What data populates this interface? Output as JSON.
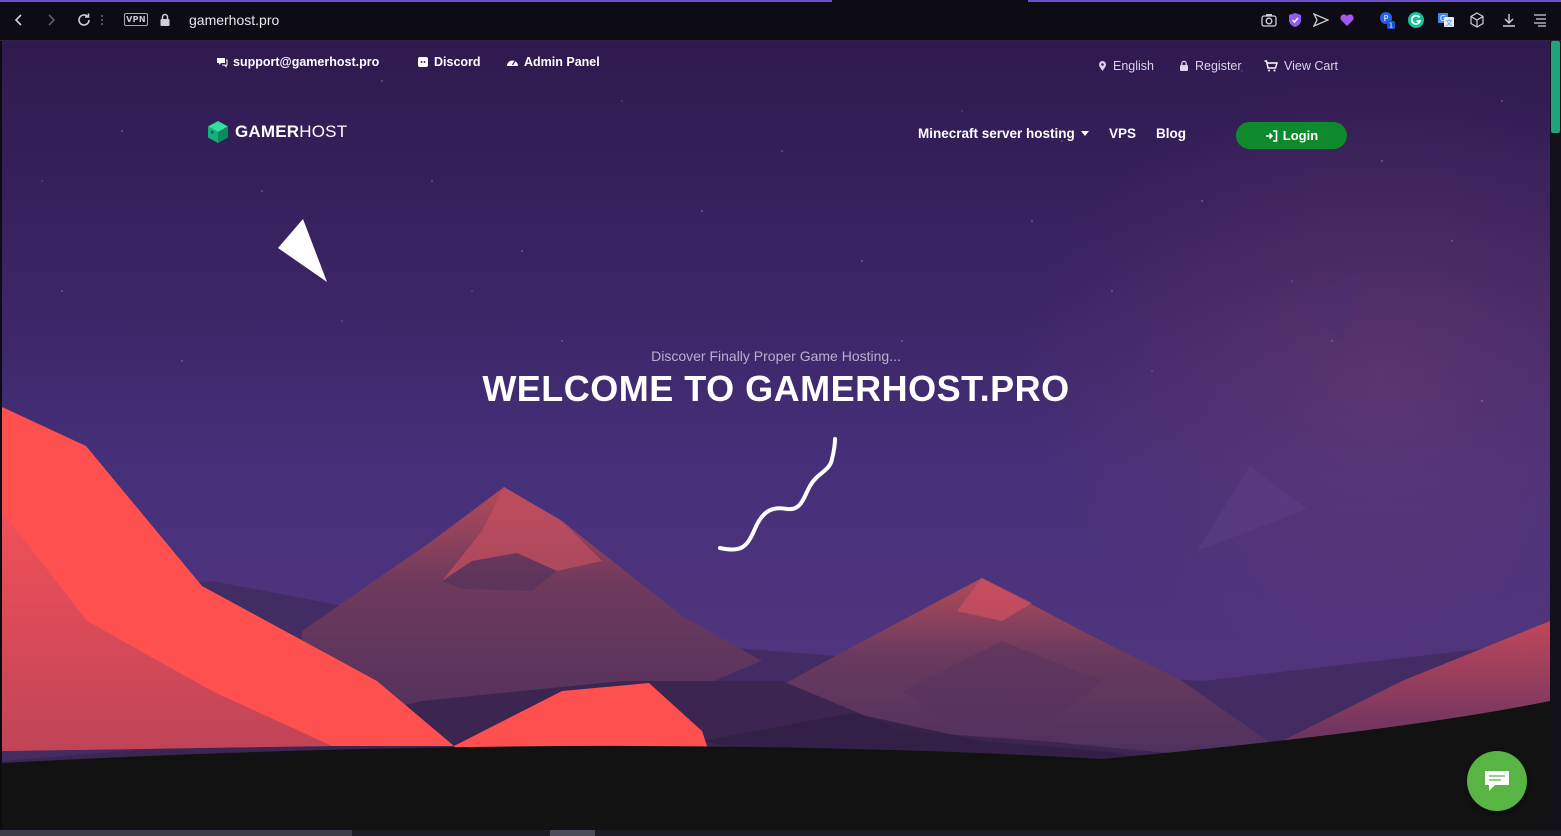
{
  "browser": {
    "vpn_label": "VPN",
    "url": "gamerhost.pro",
    "extension_badge": "1",
    "icons": [
      "back-icon",
      "forward-icon",
      "reload-icon",
      "more-icon",
      "vpn-icon",
      "lock-icon",
      "camera-icon",
      "shield-icon",
      "send-icon",
      "heart-icon",
      "extension-icon",
      "grammarly-icon",
      "translate-icon",
      "cube-icon",
      "download-icon",
      "menu-icon"
    ]
  },
  "topbar": {
    "support_email": "support@gamerhost.pro",
    "discord": "Discord",
    "admin_panel": "Admin Panel",
    "language": "English",
    "register": "Register",
    "view_cart": "View Cart"
  },
  "logo": {
    "bold": "GAMER",
    "light": "HOST"
  },
  "nav": {
    "items": [
      {
        "label": "Minecraft server hosting",
        "has_dropdown": true
      },
      {
        "label": "VPS"
      },
      {
        "label": "Blog"
      }
    ],
    "login": "Login"
  },
  "hero": {
    "subtitle": "Discover Finally Proper Game Hosting...",
    "title": "WELCOME TO GAMERHOST.PRO"
  },
  "colors": {
    "accent_green": "#0e8a2c",
    "chat_green": "#58b443",
    "mountain_red": "#ff5050",
    "sky_purple": "#3a2464"
  }
}
